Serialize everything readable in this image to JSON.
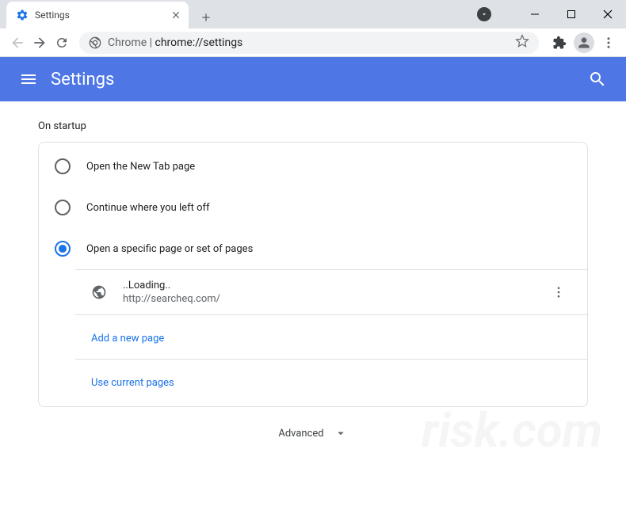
{
  "window": {
    "tab_title": "Settings"
  },
  "omnibox": {
    "origin": "Chrome",
    "path": "chrome://settings"
  },
  "header": {
    "title": "Settings"
  },
  "startup": {
    "section_title": "On startup",
    "options": [
      {
        "label": "Open the New Tab page",
        "checked": false
      },
      {
        "label": "Continue where you left off",
        "checked": false
      },
      {
        "label": "Open a specific page or set of pages",
        "checked": true
      }
    ],
    "pages": [
      {
        "title": "..Loading..",
        "url": "http://searcheq.com/"
      }
    ],
    "add_page_label": "Add a new page",
    "use_current_label": "Use current pages"
  },
  "advanced_label": "Advanced"
}
